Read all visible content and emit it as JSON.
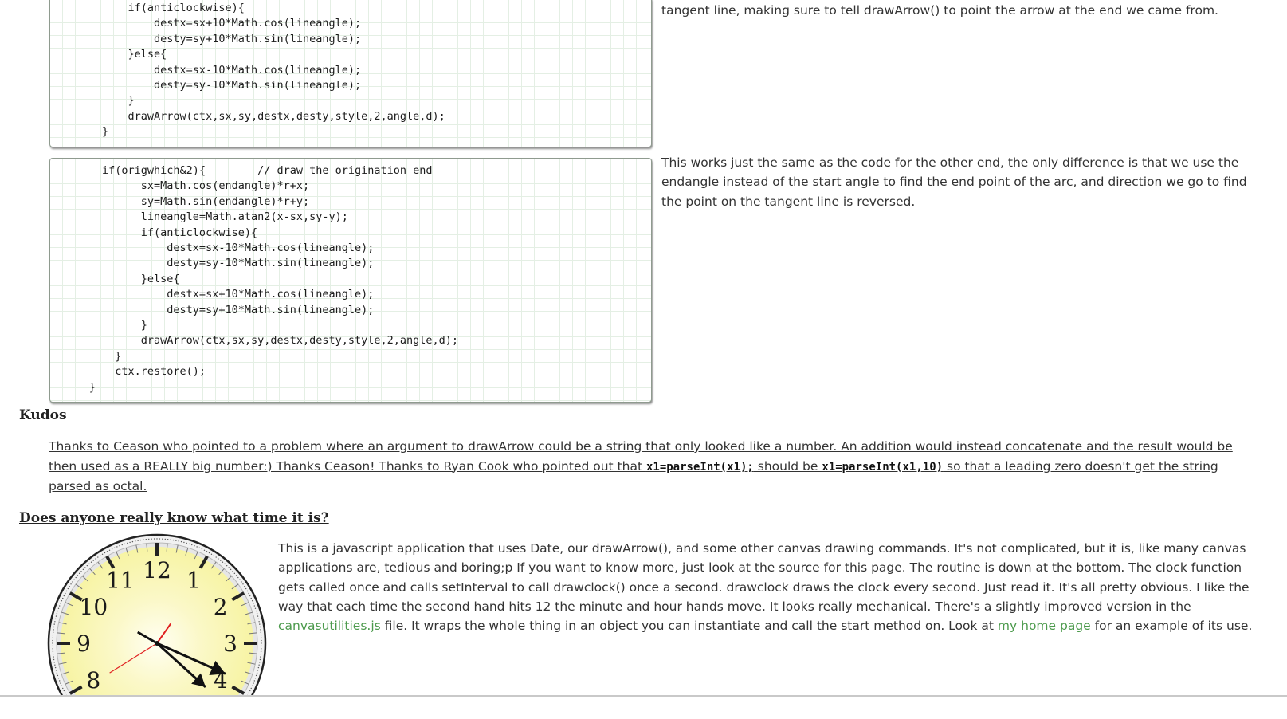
{
  "code_block_1": {
    "lines": [
      "            if(anticlockwise){",
      "                destx=sx+10*Math.cos(lineangle);",
      "                desty=sy+10*Math.sin(lineangle);",
      "            }else{",
      "                destx=sx-10*Math.cos(lineangle);",
      "                desty=sy-10*Math.sin(lineangle);",
      "            }",
      "            drawArrow(ctx,sx,sy,destx,desty,style,2,angle,d);",
      "        }"
    ]
  },
  "code_block_2": {
    "lines": [
      "        if(origwhich&2){        // draw the origination end",
      "              sx=Math.cos(endangle)*r+x;",
      "              sy=Math.sin(endangle)*r+y;",
      "              lineangle=Math.atan2(x-sx,sy-y);",
      "              if(anticlockwise){",
      "                  destx=sx-10*Math.cos(lineangle);",
      "                  desty=sy-10*Math.sin(lineangle);",
      "              }else{",
      "                  destx=sx+10*Math.cos(lineangle);",
      "                  desty=sy+10*Math.sin(lineangle);",
      "              }",
      "              drawArrow(ctx,sx,sy,destx,desty,style,2,angle,d);",
      "          }",
      "          ctx.restore();",
      "      }"
    ]
  },
  "desc_1": "tangent line, making sure to tell drawArrow() to point the arrow at the end we came from.",
  "desc_2": "This works just the same as the code for the other end, the only difference is that we use the endangle instead of the start angle to find the end point of the arc, and direction we go to find the point on the tangent line is reversed.",
  "kudos": {
    "heading": "Kudos",
    "text_1": "Thanks to Ceason who pointed to a problem where an argument to drawArrow could be a string that only looked like a number. An addition would instead concatenate and the result would be then used as a REALLY big number:) Thanks Ceason! Thanks to Ryan Cook who pointed out that ",
    "code_1": "x1=parseInt(x1);",
    "text_2": " should be ",
    "code_2": "x1=parseInt(x1,10)",
    "text_3": " so that a leading zero doesn't get the string parsed as octal."
  },
  "clock_section": {
    "heading": "Does anyone really know what time it is?",
    "text_1": "This is a javascript application that uses Date, our drawArrow(), and some other canvas drawing commands. It's not complicated, but it is, like many canvas applications are, tedious and boring;p If you want to know more, just look at the source for this page. The routine is down at the bottom. The clock function gets called once and calls setInterval to call drawclock() once a second. drawclock draws the clock every second. Just read it. It's all pretty obvious. I like the way that each time the second hand hits 12 the minute and hour hands move. It looks really mechanical. There's a slightly improved version in the ",
    "link_1": "canvasutilities.js",
    "text_2": " file. It wraps the whole thing in an object you can instantiate and call the start method on. Look at ",
    "link_2": "my home page",
    "text_3": " for an example of its use."
  },
  "clock": {
    "numerals": [
      "12",
      "1",
      "2",
      "3",
      "4",
      "8",
      "9",
      "10",
      "11"
    ],
    "hour_value": 3.8,
    "minute_value": 20,
    "second_value": 38,
    "face_color": "#f7f4a4",
    "center_color": "#fffff2",
    "second_hand_color": "#e02020",
    "hand_color": "#111111"
  }
}
